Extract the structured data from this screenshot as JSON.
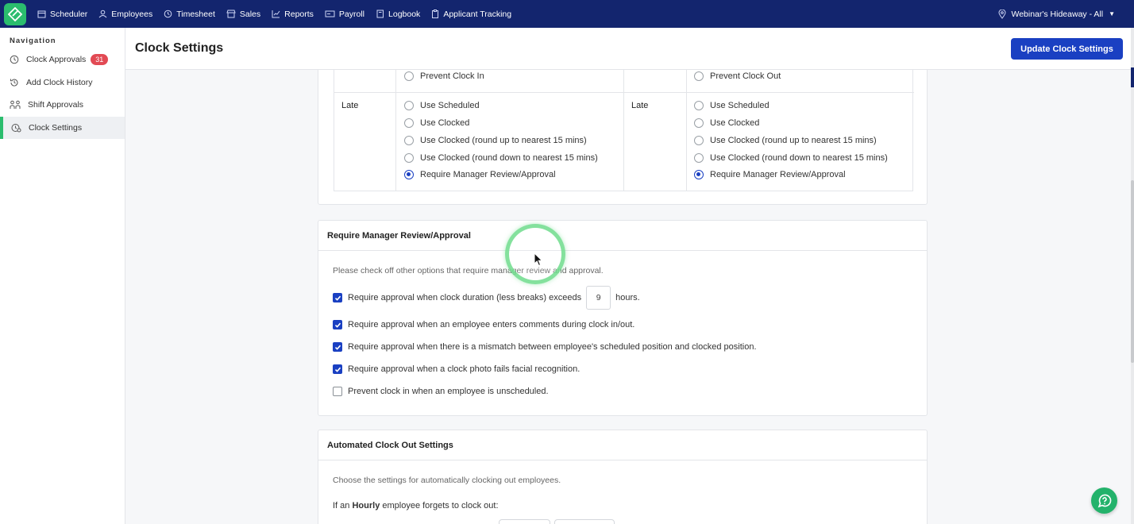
{
  "topnav": {
    "items": [
      {
        "label": "Scheduler",
        "icon": "calendar-icon"
      },
      {
        "label": "Employees",
        "icon": "user-icon"
      },
      {
        "label": "Timesheet",
        "icon": "clock-icon"
      },
      {
        "label": "Sales",
        "icon": "store-icon"
      },
      {
        "label": "Reports",
        "icon": "chart-icon"
      },
      {
        "label": "Payroll",
        "icon": "money-icon"
      },
      {
        "label": "Logbook",
        "icon": "book-icon"
      },
      {
        "label": "Applicant Tracking",
        "icon": "clipboard-icon"
      }
    ],
    "location": "Webinar's Hideaway - All"
  },
  "sidebar": {
    "title": "Navigation",
    "items": [
      {
        "label": "Clock Approvals",
        "badge": "31"
      },
      {
        "label": "Add Clock History"
      },
      {
        "label": "Shift Approvals"
      },
      {
        "label": "Clock Settings",
        "active": true
      }
    ]
  },
  "header": {
    "title": "Clock Settings",
    "update_button": "Update Clock Settings"
  },
  "rules": {
    "left": {
      "prevent_label": "Prevent Clock In",
      "late_label": "Late",
      "options": [
        "Use Scheduled",
        "Use Clocked",
        "Use Clocked (round up to nearest 15 mins)",
        "Use Clocked (round down to nearest 15 mins)",
        "Require Manager Review/Approval"
      ],
      "selected": 4
    },
    "right": {
      "prevent_label": "Prevent Clock Out",
      "late_label": "Late",
      "options": [
        "Use Scheduled",
        "Use Clocked",
        "Use Clocked (round up to nearest 15 mins)",
        "Use Clocked (round down to nearest 15 mins)",
        "Require Manager Review/Approval"
      ],
      "selected": 4
    }
  },
  "review": {
    "title": "Require Manager Review/Approval",
    "description": "Please check off other options that require manager review and approval.",
    "duration_prefix": "Require approval when clock duration (less breaks) exceeds",
    "duration_value": "9",
    "duration_suffix": "hours.",
    "duration_checked": true,
    "options": [
      {
        "label": "Require approval when an employee enters comments during clock in/out.",
        "checked": true
      },
      {
        "label": "Require approval when there is a mismatch between employee's scheduled position and clocked position.",
        "checked": true
      },
      {
        "label": "Require approval when a clock photo fails facial recognition.",
        "checked": true
      },
      {
        "label": "Prevent clock in when an employee is unscheduled.",
        "checked": false
      }
    ]
  },
  "auto": {
    "title": "Automated Clock Out Settings",
    "description": "Choose the settings for automatically clocking out employees.",
    "forgets_prefix": "If an",
    "forgets_bold": "Hourly",
    "forgets_suffix": "employee forgets to clock out:"
  },
  "colors": {
    "topbar": "#13256e",
    "accent": "#1a40c2",
    "brand_green": "#2bbd6e",
    "badge_red": "#e24a54"
  }
}
